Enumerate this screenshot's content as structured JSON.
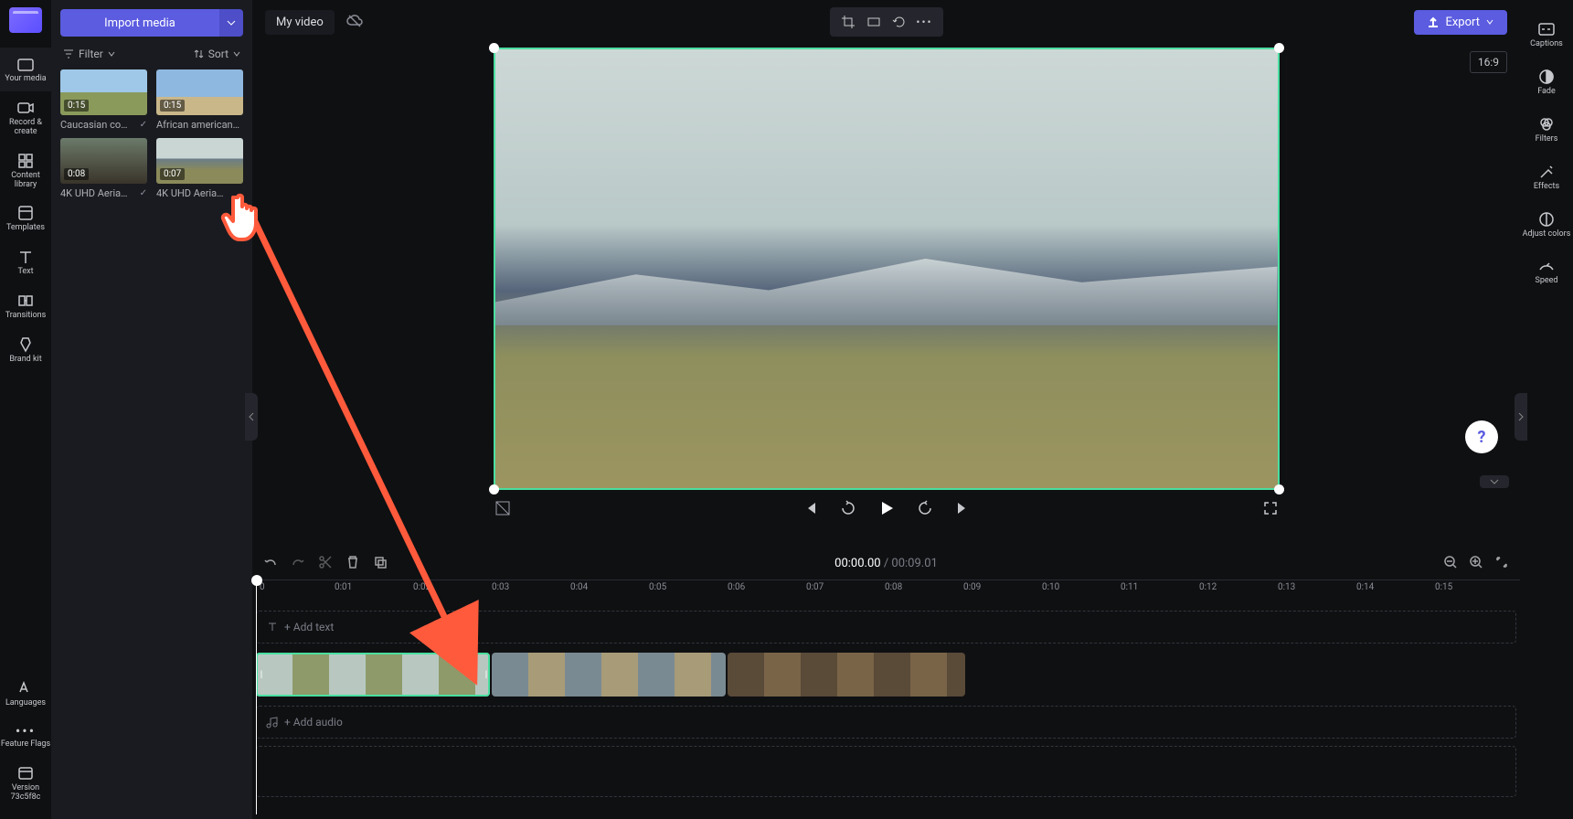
{
  "leftRail": {
    "items": [
      {
        "label": "Your media"
      },
      {
        "label": "Record & create"
      },
      {
        "label": "Content library"
      },
      {
        "label": "Templates"
      },
      {
        "label": "Text"
      },
      {
        "label": "Transitions"
      },
      {
        "label": "Brand kit"
      }
    ],
    "bottom": [
      {
        "label": "Languages"
      },
      {
        "label": "Feature Flags"
      },
      {
        "label": "Version 73c5f8c"
      }
    ]
  },
  "mediaPanel": {
    "importLabel": "Import media",
    "filterLabel": "Filter",
    "sortLabel": "Sort",
    "clips": [
      {
        "duration": "0:15",
        "title": "Caucasian co…",
        "used": true
      },
      {
        "duration": "0:15",
        "title": "African american…",
        "used": false
      },
      {
        "duration": "0:08",
        "title": "4K UHD Aeria…",
        "used": true
      },
      {
        "duration": "0:07",
        "title": "4K UHD Aeria…",
        "used": false
      }
    ]
  },
  "topBar": {
    "title": "My video",
    "export": "Export",
    "aspect": "16:9"
  },
  "rightRail": {
    "items": [
      {
        "label": "Captions"
      },
      {
        "label": "Fade"
      },
      {
        "label": "Filters"
      },
      {
        "label": "Effects"
      },
      {
        "label": "Adjust colors"
      },
      {
        "label": "Speed"
      }
    ]
  },
  "playback": {
    "current": "00:00.00",
    "total": "00:09.01"
  },
  "ruler": [
    "0",
    "0:01",
    "0:02",
    "0:03",
    "0:04",
    "0:05",
    "0:06",
    "0:07",
    "0:08",
    "0:09",
    "0:10",
    "0:11",
    "0:12",
    "0:13",
    "0:14",
    "0:15"
  ],
  "tracks": {
    "addText": "+ Add text",
    "addAudio": "+ Add audio"
  },
  "help": "?"
}
